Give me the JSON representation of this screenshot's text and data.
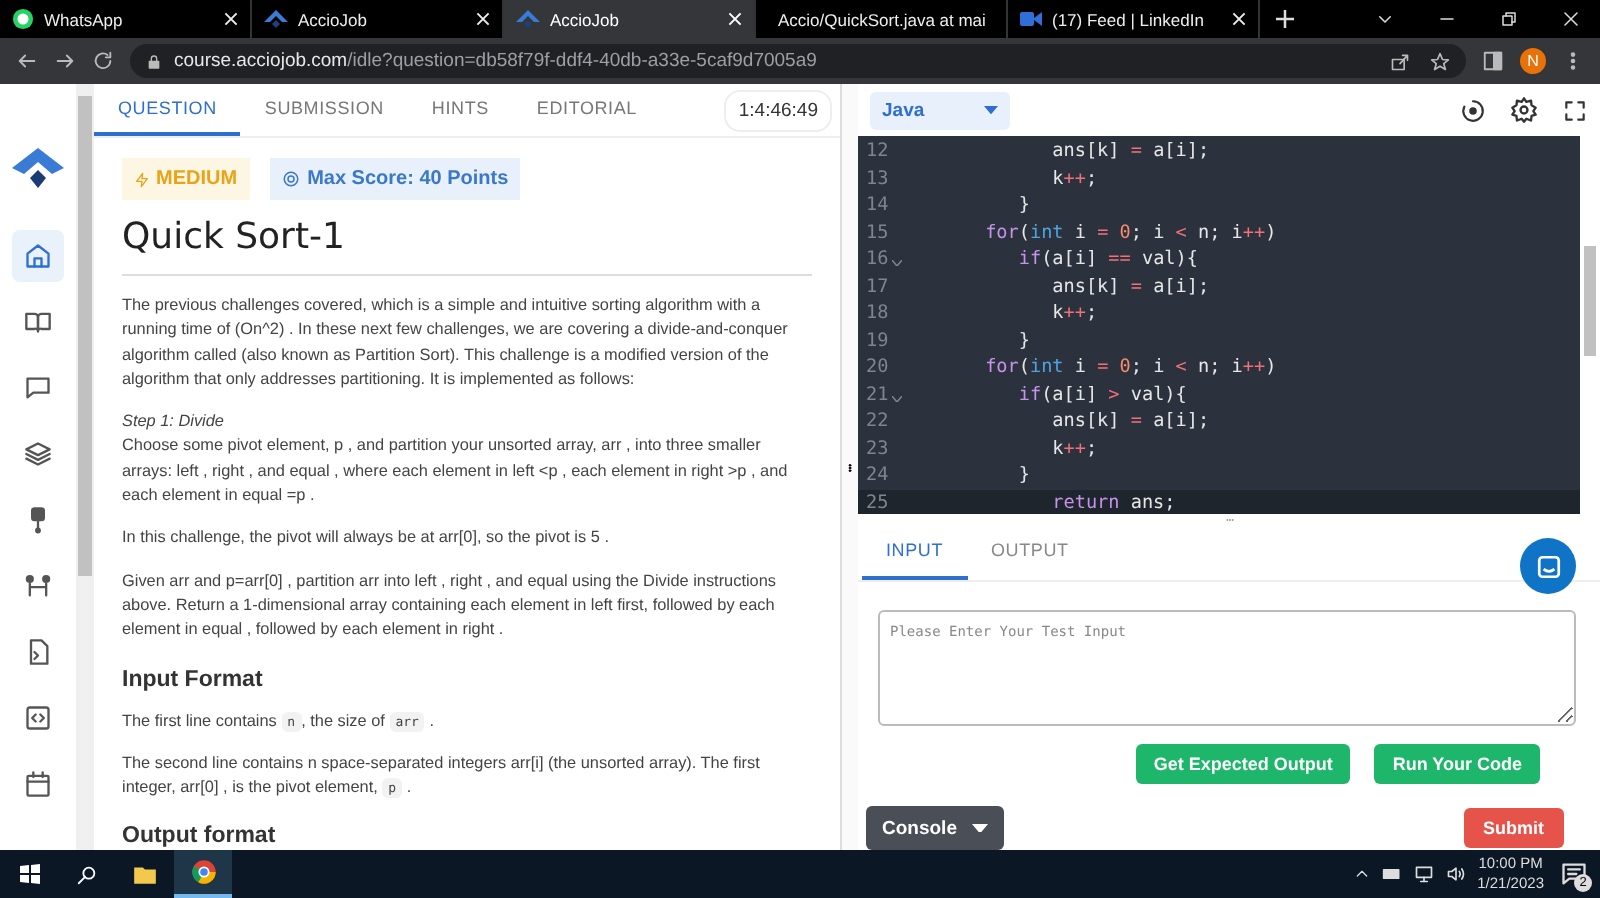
{
  "browser": {
    "tabs": [
      {
        "title": "WhatsApp",
        "selected": false
      },
      {
        "title": "AccioJob",
        "selected": false
      },
      {
        "title": "AccioJob",
        "selected": true
      },
      {
        "title": "Accio/QuickSort.java at mai",
        "selected": false
      },
      {
        "title": "(17) Feed | LinkedIn",
        "selected": false
      }
    ],
    "url_host": "course.acciojob.com",
    "url_path": "/idle?question=db58f79f-ddf4-40db-a33e-5caf9d7005a9",
    "profile": "N"
  },
  "sidebar": {
    "items": [
      {
        "selected": true
      },
      {
        "selected": false
      },
      {
        "selected": false
      },
      {
        "selected": false
      },
      {
        "selected": false
      },
      {
        "selected": false
      },
      {
        "selected": false
      },
      {
        "selected": false
      },
      {
        "selected": false
      }
    ]
  },
  "question": {
    "tabs": [
      {
        "label": "QUESTION",
        "selected": true
      },
      {
        "label": "SUBMISSION",
        "selected": false
      },
      {
        "label": "HINTS",
        "selected": false
      },
      {
        "label": "EDITORIAL",
        "selected": false
      }
    ],
    "timer": "1:4:46:49",
    "difficulty": "MEDIUM",
    "max_score": "Max Score: 40 Points",
    "title": "Quick Sort-1",
    "blocks": [
      {
        "kind": "para",
        "parts": [
          {
            "kind": "text",
            "text": "The previous challenges covered, which is a simple and intuitive sorting algorithm with a running time of (On^2) . In these next few challenges, we are covering a divide-and-conquer algorithm called (also known as Partition Sort). This challenge is a modified version of the algorithm that only addresses partitioning. It is implemented as follows:"
          }
        ]
      },
      {
        "kind": "step",
        "text": "Step 1: Divide"
      },
      {
        "kind": "para_tight",
        "parts": [
          {
            "kind": "text",
            "text": "Choose some pivot element, p , and partition your unsorted array, arr , into three smaller arrays: left , right , and equal , where each element in left <p , each element in right >p , and each element in equal =p ."
          }
        ]
      },
      {
        "kind": "para",
        "parts": [
          {
            "kind": "text",
            "text": "In this challenge, the pivot will always be at arr[0], so the pivot is 5 ."
          }
        ]
      },
      {
        "kind": "para",
        "parts": [
          {
            "kind": "text",
            "text": "Given arr and p=arr[0] , partition arr into left , right , and equal using the Divide instructions above. Return a 1-dimensional array containing each element in left first, followed by each element in equal , followed by each element in right ."
          }
        ]
      },
      {
        "kind": "heading",
        "text": "Input Format"
      },
      {
        "kind": "para",
        "parts": [
          {
            "kind": "text",
            "text": "The first line contains "
          },
          {
            "kind": "code",
            "text": "n"
          },
          {
            "kind": "text",
            "text": ", the size of "
          },
          {
            "kind": "code",
            "text": "arr"
          },
          {
            "kind": "text",
            "text": " ."
          }
        ]
      },
      {
        "kind": "para",
        "parts": [
          {
            "kind": "text",
            "text": "The second line contains n space-separated integers arr[i] (the unsorted array). The first integer, arr[0] , is the pivot element, "
          },
          {
            "kind": "code",
            "text": "p"
          },
          {
            "kind": "text",
            "text": " ."
          }
        ]
      },
      {
        "kind": "heading",
        "text": "Output format"
      }
    ]
  },
  "editor": {
    "language": "Java",
    "lines": [
      {
        "number": "12",
        "fold": false,
        "current": false,
        "tokens": [
          {
            "kind": "plain",
            "text": "            ans[k] "
          },
          {
            "kind": "op",
            "text": "="
          },
          {
            "kind": "plain",
            "text": " a[i];"
          }
        ]
      },
      {
        "number": "13",
        "fold": false,
        "current": false,
        "tokens": [
          {
            "kind": "plain",
            "text": "            k"
          },
          {
            "kind": "op",
            "text": "++"
          },
          {
            "kind": "plain",
            "text": ";"
          }
        ]
      },
      {
        "number": "14",
        "fold": false,
        "current": false,
        "tokens": [
          {
            "kind": "plain",
            "text": "         }"
          }
        ]
      },
      {
        "number": "15",
        "fold": false,
        "current": false,
        "tokens": [
          {
            "kind": "keyword",
            "text": "      for"
          },
          {
            "kind": "plain",
            "text": "("
          },
          {
            "kind": "type",
            "text": "int"
          },
          {
            "kind": "plain",
            "text": " i "
          },
          {
            "kind": "op",
            "text": "= "
          },
          {
            "kind": "num",
            "text": "0"
          },
          {
            "kind": "plain",
            "text": "; i "
          },
          {
            "kind": "op",
            "text": "<"
          },
          {
            "kind": "plain",
            "text": " n; i"
          },
          {
            "kind": "op",
            "text": "++"
          },
          {
            "kind": "plain",
            "text": ")"
          }
        ]
      },
      {
        "number": "16",
        "fold": true,
        "current": false,
        "tokens": [
          {
            "kind": "keyword",
            "text": "         if"
          },
          {
            "kind": "plain",
            "text": "(a[i] "
          },
          {
            "kind": "op",
            "text": "=="
          },
          {
            "kind": "plain",
            "text": " val){"
          }
        ]
      },
      {
        "number": "17",
        "fold": false,
        "current": false,
        "tokens": [
          {
            "kind": "plain",
            "text": "            ans[k] "
          },
          {
            "kind": "op",
            "text": "="
          },
          {
            "kind": "plain",
            "text": " a[i];"
          }
        ]
      },
      {
        "number": "18",
        "fold": false,
        "current": false,
        "tokens": [
          {
            "kind": "plain",
            "text": "            k"
          },
          {
            "kind": "op",
            "text": "++"
          },
          {
            "kind": "plain",
            "text": ";"
          }
        ]
      },
      {
        "number": "19",
        "fold": false,
        "current": false,
        "tokens": [
          {
            "kind": "plain",
            "text": "         }"
          }
        ]
      },
      {
        "number": "20",
        "fold": false,
        "current": false,
        "tokens": [
          {
            "kind": "keyword",
            "text": "      for"
          },
          {
            "kind": "plain",
            "text": "("
          },
          {
            "kind": "type",
            "text": "int"
          },
          {
            "kind": "plain",
            "text": " i "
          },
          {
            "kind": "op",
            "text": "= "
          },
          {
            "kind": "num",
            "text": "0"
          },
          {
            "kind": "plain",
            "text": "; i "
          },
          {
            "kind": "op",
            "text": "<"
          },
          {
            "kind": "plain",
            "text": " n; i"
          },
          {
            "kind": "op",
            "text": "++"
          },
          {
            "kind": "plain",
            "text": ")"
          }
        ]
      },
      {
        "number": "21",
        "fold": true,
        "current": false,
        "tokens": [
          {
            "kind": "keyword",
            "text": "         if"
          },
          {
            "kind": "plain",
            "text": "(a[i] "
          },
          {
            "kind": "op",
            "text": ">"
          },
          {
            "kind": "plain",
            "text": " val){"
          }
        ]
      },
      {
        "number": "22",
        "fold": false,
        "current": false,
        "tokens": [
          {
            "kind": "plain",
            "text": "            ans[k] "
          },
          {
            "kind": "op",
            "text": "="
          },
          {
            "kind": "plain",
            "text": " a[i];"
          }
        ]
      },
      {
        "number": "23",
        "fold": false,
        "current": false,
        "tokens": [
          {
            "kind": "plain",
            "text": "            k"
          },
          {
            "kind": "op",
            "text": "++"
          },
          {
            "kind": "plain",
            "text": ";"
          }
        ]
      },
      {
        "number": "24",
        "fold": false,
        "current": false,
        "tokens": [
          {
            "kind": "plain",
            "text": "         }"
          }
        ]
      },
      {
        "number": "25",
        "fold": false,
        "current": true,
        "tokens": [
          {
            "kind": "keyword",
            "text": "            return"
          },
          {
            "kind": "plain",
            "text": " ans;"
          }
        ]
      }
    ]
  },
  "io": {
    "tabs": [
      {
        "label": "INPUT",
        "selected": true
      },
      {
        "label": "OUTPUT",
        "selected": false
      }
    ],
    "placeholder": "Please Enter Your Test Input",
    "buttons": [
      "Get Expected Output",
      "Run Your Code"
    ],
    "console": "Console",
    "submit": "Submit"
  },
  "taskbar": {
    "time": "10:00 PM",
    "date": "1/21/2023",
    "notifications": "2"
  }
}
